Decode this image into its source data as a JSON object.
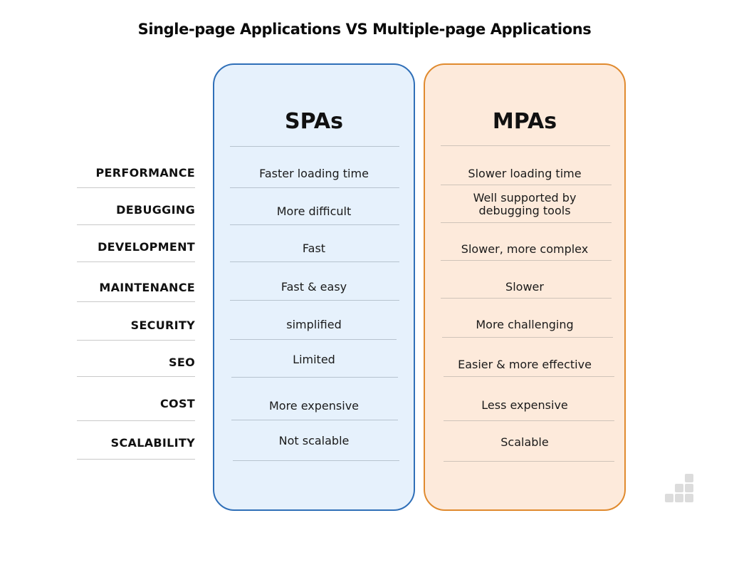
{
  "title": "Single-page Applications VS Multiple-page Applications",
  "columns": {
    "spa": {
      "header": "SPAs",
      "accent_color": "#2f6fb8",
      "background_color": "#e6f1fc"
    },
    "mpa": {
      "header": "MPAs",
      "accent_color": "#e08a2e",
      "background_color": "#fdeadb"
    }
  },
  "rows": [
    {
      "label": "PERFORMANCE",
      "spa": "Faster loading time",
      "mpa": "Slower loading time"
    },
    {
      "label": "DEBUGGING",
      "spa": "More difficult",
      "mpa": "Well supported by debugging tools",
      "mpa_line1": "Well supported by",
      "mpa_line2": "debugging tools"
    },
    {
      "label": "DEVELOPMENT",
      "spa": "Fast",
      "mpa": "Slower, more complex"
    },
    {
      "label": "MAINTENANCE",
      "spa": "Fast & easy",
      "mpa": "Slower"
    },
    {
      "label": "SECURITY",
      "spa": "simplified",
      "mpa": "More challenging"
    },
    {
      "label": "SEO",
      "spa": "Limited",
      "mpa": "Easier & more effective"
    },
    {
      "label": "COST",
      "spa": "More expensive",
      "mpa": "Less expensive"
    },
    {
      "label": "SCALABILITY",
      "spa": "Not scalable",
      "mpa": "Scalable"
    }
  ],
  "logo": {
    "icon": "bar-steps-logo-icon"
  }
}
